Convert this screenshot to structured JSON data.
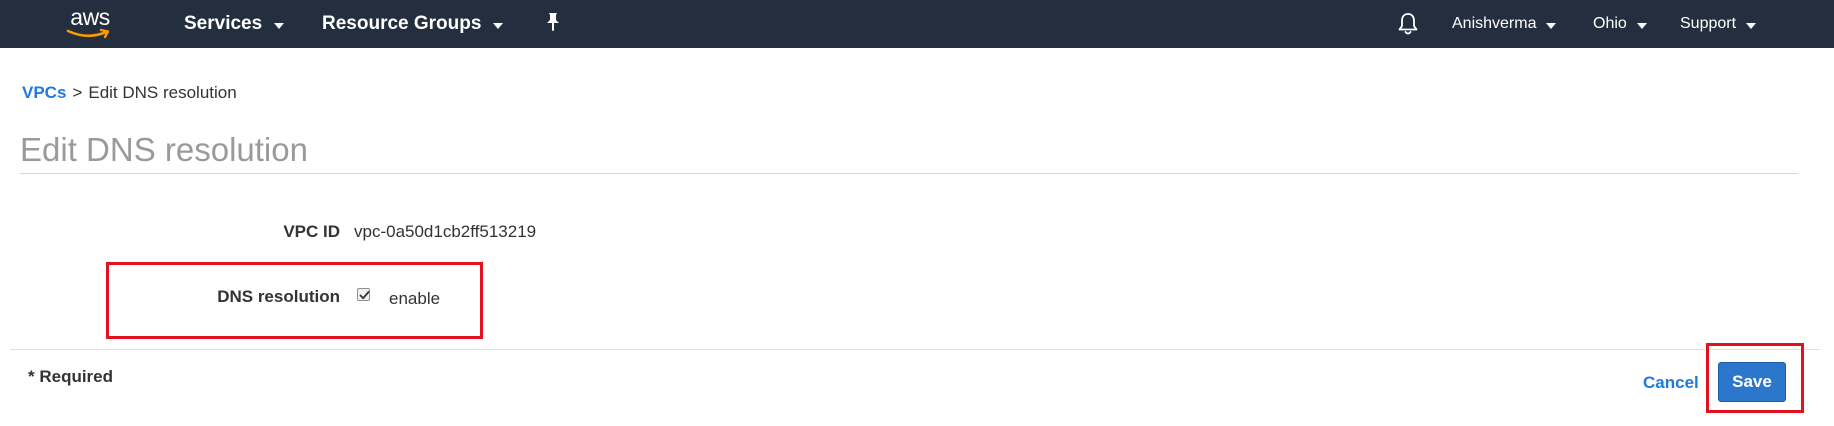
{
  "nav": {
    "logo_text": "aws",
    "services_label": "Services",
    "resource_groups_label": "Resource Groups",
    "pin_icon": "pin-icon",
    "bell_icon": "bell-icon",
    "user_label": "Anishverma",
    "region_label": "Ohio",
    "support_label": "Support",
    "bg_color": "#232f3e"
  },
  "breadcrumb": {
    "parent_label": "VPCs",
    "separator": ">",
    "current_label": "Edit DNS resolution"
  },
  "page": {
    "title": "Edit DNS resolution"
  },
  "form": {
    "vpc_id_label": "VPC ID",
    "vpc_id_value": "vpc-0a50d1cb2ff513219",
    "dns_resolution_label": "DNS resolution",
    "dns_enable_label": "enable",
    "dns_enable_checked": true
  },
  "footer": {
    "required_note": "* Required",
    "cancel_label": "Cancel",
    "save_label": "Save"
  },
  "colors": {
    "link": "#1f7ae0",
    "primary_button": "#2a77cc",
    "highlight": "#e0141e"
  }
}
